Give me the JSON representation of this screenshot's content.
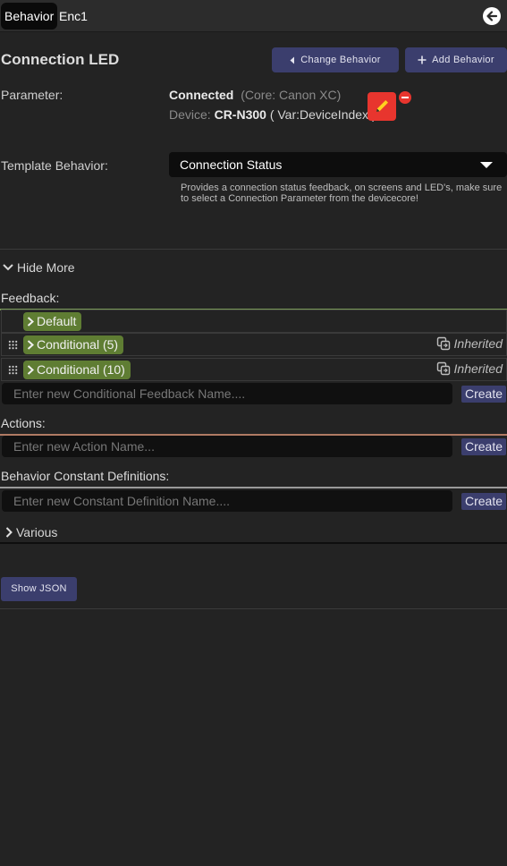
{
  "header": {
    "active_tab": "Behavior",
    "tab2": "Enc1"
  },
  "title": "Connection LED",
  "buttons": {
    "change_behavior": "Change Behavior",
    "add_behavior": "Add Behavior",
    "show_json": "Show JSON"
  },
  "parameter": {
    "label": "Parameter:",
    "status": "Connected",
    "core": "(Core: Canon XC)",
    "device_prefix": "Device:",
    "device_name": "CR-N300",
    "var": "( Var:DeviceIndex )"
  },
  "template": {
    "label": "Template Behavior:",
    "selected": "Connection Status",
    "description": "Provides a connection status feedback, on screens and LED's, make sure to select a Connection Parameter from the devicecore!"
  },
  "hide_more": "Hide More",
  "feedback": {
    "label": "Feedback:",
    "items": [
      {
        "label": "Default",
        "inherited": ""
      },
      {
        "label": "Conditional (5)",
        "inherited": "Inherited"
      },
      {
        "label": "Conditional (10)",
        "inherited": "Inherited"
      }
    ],
    "placeholder": "Enter new Conditional Feedback Name....",
    "create": "Create"
  },
  "actions": {
    "label": "Actions:",
    "placeholder": "Enter new Action Name...",
    "create": "Create"
  },
  "constants": {
    "label": "Behavior Constant Definitions:",
    "placeholder": "Enter new Constant Definition Name....",
    "create": "Create"
  },
  "various": "Various",
  "colors": {
    "background": "#232323",
    "button": "#3b3e6d",
    "pill": "#5f7d33",
    "danger": "#e8352e",
    "feedback_line": "#7a9a57",
    "actions_line": "#b07a63",
    "constants_line": "#9a9a9a"
  }
}
